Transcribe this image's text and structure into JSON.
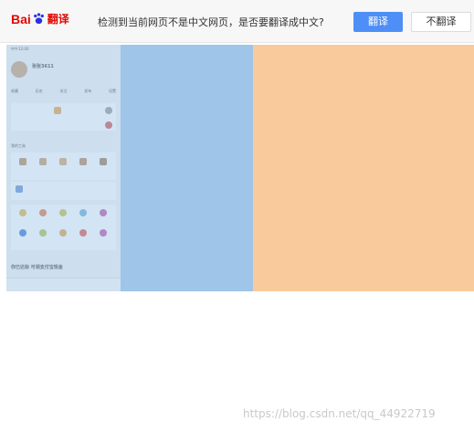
{
  "translate_bar": {
    "logo_text": "Bai",
    "logo_suffix": "翻译",
    "message": "检测到当前网页不是中文网页，是否要翻译成中文?",
    "translate_button": "翻译",
    "no_translate_button": "不翻译"
  },
  "phone": {
    "username": "张张3611",
    "status_time": "中午12:00",
    "grid_labels": [
      "收藏",
      "历史",
      "关注",
      "发布",
      "设置"
    ],
    "section_title": "我的工具",
    "bottom_banner": "你已达标 可领支付宝现金"
  },
  "watermark": "https://blog.csdn.net/qq_44922719",
  "colors": {
    "blue_panel": "#9fc5e8",
    "orange_panel": "#f9cb9c",
    "translate_button": "#4e8ef7",
    "brand_red": "#e10601"
  }
}
